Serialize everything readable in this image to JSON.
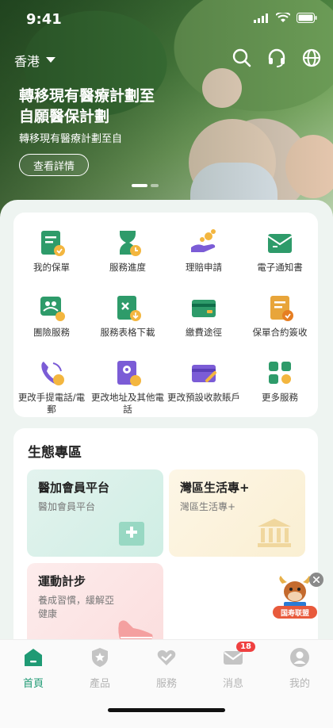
{
  "status": {
    "time": "9:41"
  },
  "header": {
    "region": "香港"
  },
  "banner": {
    "title": "轉移現有醫療計劃至自願醫保計劃",
    "subtitle": "轉移現有醫療計劃至自",
    "button": "查看詳情"
  },
  "services": [
    {
      "label": "我的保單",
      "icon": "policy-document-icon",
      "color": "#2e9b6a"
    },
    {
      "label": "服務進度",
      "icon": "hourglass-icon",
      "color": "#2e9b6a"
    },
    {
      "label": "理賠申請",
      "icon": "claim-hand-icon",
      "color": "#7b5cd6"
    },
    {
      "label": "電子通知書",
      "icon": "e-notice-icon",
      "color": "#2e9b6a"
    },
    {
      "label": "團險服務",
      "icon": "group-insurance-icon",
      "color": "#2e9b6a"
    },
    {
      "label": "服務表格下載",
      "icon": "form-download-icon",
      "color": "#2e9b6a"
    },
    {
      "label": "繳費途徑",
      "icon": "payment-card-icon",
      "color": "#2e9b6a"
    },
    {
      "label": "保單合約簽收",
      "icon": "contract-sign-icon",
      "color": "#e8a53a"
    },
    {
      "label": "更改手提電話/電郵",
      "icon": "phone-change-icon",
      "color": "#7b5cd6"
    },
    {
      "label": "更改地址及其他電話",
      "icon": "address-change-icon",
      "color": "#7b5cd6"
    },
    {
      "label": "更改預設收款賬戶",
      "icon": "bank-account-icon",
      "color": "#7b5cd6"
    },
    {
      "label": "更多服務",
      "icon": "more-services-icon",
      "color": "#2e9b6a"
    }
  ],
  "eco": {
    "title": "生態專區",
    "tiles": [
      {
        "title": "醫加會員平台",
        "subtitle": "醫加會員平台"
      },
      {
        "title": "灣區生活專+",
        "subtitle": "灣區生活專+"
      },
      {
        "title": "運動計步",
        "subtitle": "養成習慣，緩解亞健康"
      }
    ]
  },
  "floating_badge": {
    "label": "国寿联盟"
  },
  "tabs": [
    {
      "label": "首頁",
      "active": true
    },
    {
      "label": "產品",
      "active": false
    },
    {
      "label": "服務",
      "active": false
    },
    {
      "label": "消息",
      "active": false,
      "badge": "18"
    },
    {
      "label": "我的",
      "active": false
    }
  ],
  "colors": {
    "accent": "#1f9a74",
    "badge": "#ef4040"
  }
}
